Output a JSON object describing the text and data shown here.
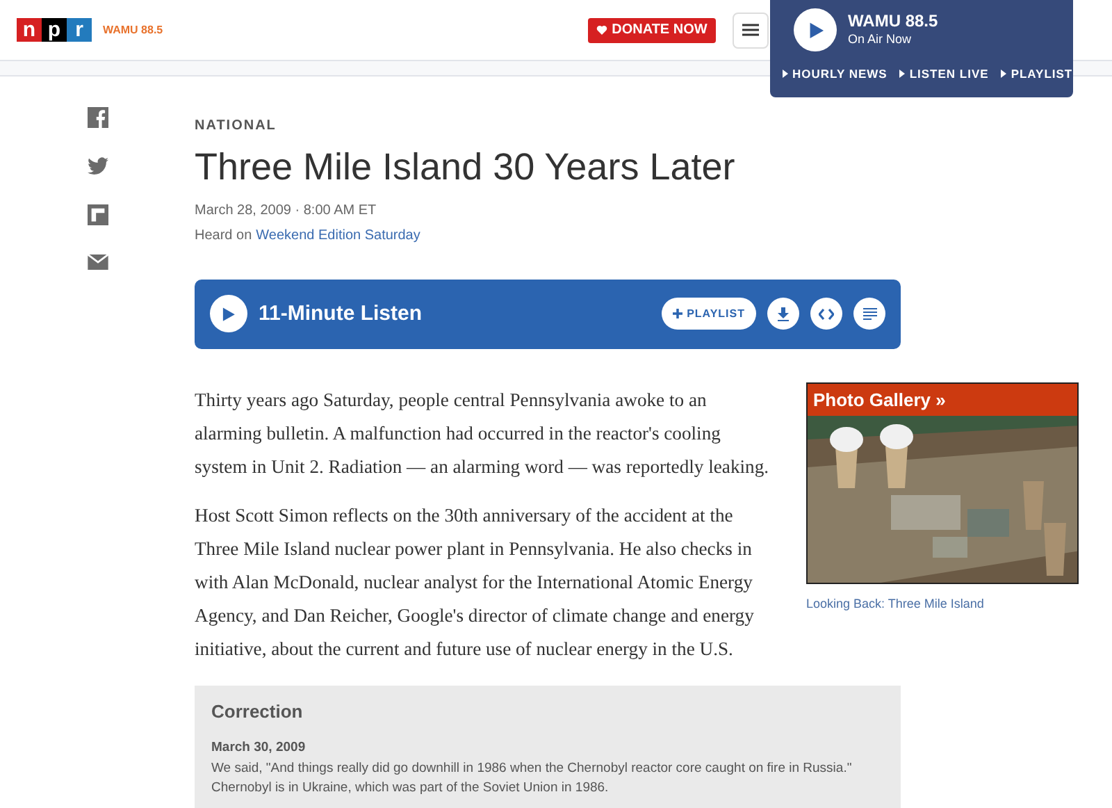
{
  "header": {
    "logo_letters": [
      "n",
      "p",
      "r"
    ],
    "station_logo": "WAMU 88.5",
    "donate": "DONATE NOW"
  },
  "player": {
    "station": "WAMU 88.5",
    "status": "On Air Now",
    "links": [
      "HOURLY NEWS",
      "LISTEN LIVE",
      "PLAYLIST"
    ]
  },
  "article": {
    "section": "NATIONAL",
    "title": "Three Mile Island 30 Years Later",
    "date": "March 28, 2009 · 8:00 AM ET",
    "heard_on": "Heard on",
    "program": "Weekend Edition Saturday",
    "audio": {
      "label": "11-Minute Listen",
      "playlist": "PLAYLIST"
    },
    "paragraphs": [
      "Thirty years ago Saturday, people central Pennsylvania awoke to an alarming bulletin. A malfunction had occurred in the reactor's cooling system in Unit 2. Radiation — an alarming word — was reportedly leaking.",
      "Host Scott Simon reflects on the 30th anniversary of the accident at the Three Mile Island nuclear power plant in Pennsylvania. He also checks in with Alan McDonald, nuclear analyst for the International Atomic Energy Agency, and Dan Reicher, Google's director of climate change and energy initiative, about the current and future use of nuclear energy in the U.S."
    ],
    "gallery": {
      "banner": "Photo Gallery »",
      "caption": "Looking Back: Three Mile Island"
    },
    "correction": {
      "heading": "Correction",
      "date": "March 30, 2009",
      "text": "We said, \"And things really did go downhill in 1986 when the Chernobyl reactor core caught on fire in Russia.\" Chernobyl is in Ukraine, which was part of the Soviet Union in 1986."
    }
  }
}
